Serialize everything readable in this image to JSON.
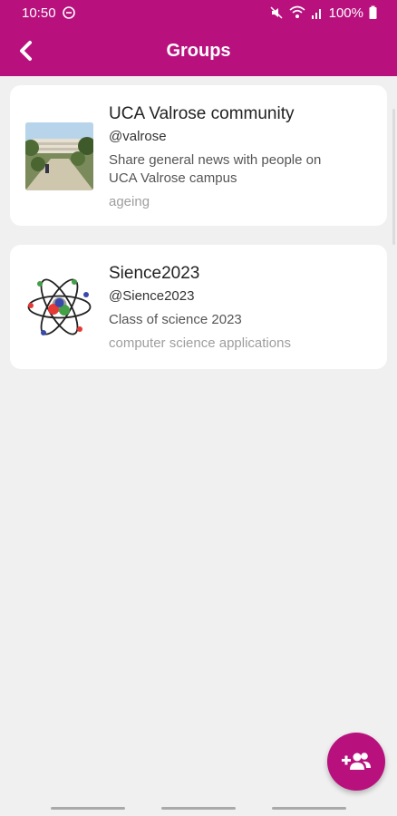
{
  "status": {
    "time": "10:50",
    "battery": "100%",
    "icons": [
      "notification-icon",
      "mute-icon",
      "wifi-icon",
      "signal-icon",
      "battery-icon"
    ]
  },
  "header": {
    "title": "Groups",
    "back_icon": "back-arrow-icon"
  },
  "groups": [
    {
      "name": "UCA Valrose community",
      "handle": "@valrose",
      "description": "Share general news with people on UCA Valrose campus",
      "tag": "ageing",
      "image": "campus-photo"
    },
    {
      "name": "Sience2023",
      "handle": "@Sience2023",
      "description": "Class of science 2023",
      "tag": "computer science applications",
      "image": "atom-logo"
    }
  ],
  "fab": {
    "icon": "add-group-icon"
  },
  "colors": {
    "primary": "#b8117e",
    "background": "#f0f0f0",
    "card": "#ffffff"
  }
}
